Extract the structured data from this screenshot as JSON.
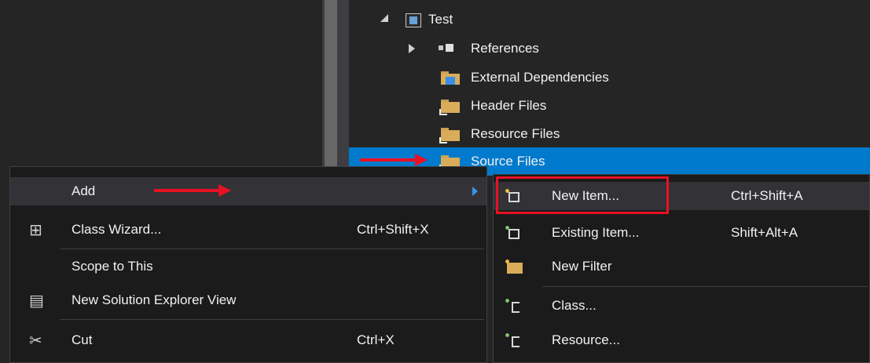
{
  "tree": {
    "project": "Test",
    "references": "References",
    "external_deps": "External Dependencies",
    "header_files": "Header Files",
    "resource_files": "Resource Files",
    "source_files": "Source Files"
  },
  "context_menu": {
    "add": "Add",
    "class_wizard": "Class Wizard...",
    "class_wizard_shortcut": "Ctrl+Shift+X",
    "scope_to_this": "Scope to This",
    "new_solution_view": "New Solution Explorer View",
    "cut": "Cut",
    "cut_shortcut": "Ctrl+X"
  },
  "add_submenu": {
    "new_item": "New Item...",
    "new_item_shortcut": "Ctrl+Shift+A",
    "existing_item": "Existing Item...",
    "existing_item_shortcut": "Shift+Alt+A",
    "new_filter": "New Filter",
    "class": "Class...",
    "resource": "Resource..."
  },
  "icons": {
    "wizard_glyph": "⊞",
    "new_view_glyph": "▤",
    "cut_glyph": "✂"
  },
  "colors": {
    "selection": "#007acc",
    "annotation": "#e81123",
    "menu_bg": "#1b1b1c"
  }
}
